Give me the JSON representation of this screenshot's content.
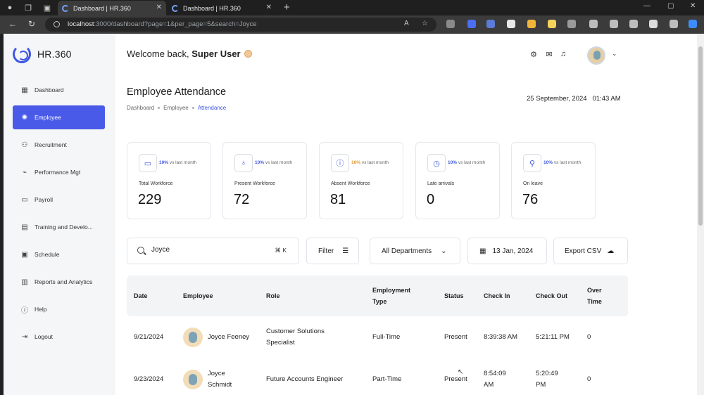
{
  "browser": {
    "tabs": [
      {
        "title": "Dashboard | HR.360",
        "active": true
      },
      {
        "title": "Dashboard | HR.360",
        "active": false
      }
    ],
    "url_host": "localhost",
    "url_path": ":3000/dashboard?page=1&per_page=5&search=Joyce"
  },
  "app": {
    "logo_text": "HR.360",
    "sidebar": [
      {
        "label": "Dashboard",
        "icon": "grid-icon",
        "active": false
      },
      {
        "label": "Employee",
        "icon": "employee-icon",
        "active": true
      },
      {
        "label": "Recruitment",
        "icon": "user-plus-icon",
        "active": false
      },
      {
        "label": "Performance Mgt",
        "icon": "chart-icon",
        "active": false
      },
      {
        "label": "Payroll",
        "icon": "wallet-icon",
        "active": false
      },
      {
        "label": "Training and Develo...",
        "icon": "book-icon",
        "active": false
      },
      {
        "label": "Schedule",
        "icon": "calendar-icon",
        "active": false
      },
      {
        "label": "Reports and Analytics",
        "icon": "report-icon",
        "active": false
      },
      {
        "label": "Help",
        "icon": "help-icon",
        "active": false
      },
      {
        "label": "Logout",
        "icon": "logout-icon",
        "active": false
      }
    ],
    "header": {
      "welcome_prefix": "Welcome back, ",
      "welcome_name": "Super User"
    },
    "page": {
      "title": "Employee Attendance",
      "breadcrumb": [
        "Dashboard",
        "Employee",
        "Attendance"
      ],
      "date": "25 September, 2024",
      "time": "01:43 AM"
    },
    "cards": [
      {
        "trend": "10%",
        "trend_suffix": " vs last month",
        "label": "Total Workforce",
        "value": "229",
        "trend_color": "#3e57e5"
      },
      {
        "trend": "10%",
        "trend_suffix": " vs last month",
        "label": "Present Workforce",
        "value": "72",
        "trend_color": "#3e57e5"
      },
      {
        "trend": "10%",
        "trend_suffix": " vs last month",
        "label": "Absent Workforce",
        "value": "81",
        "trend_color": "#e0962a"
      },
      {
        "trend": "10%",
        "trend_suffix": " vs last month",
        "label": "Late arrivals",
        "value": "0",
        "trend_color": "#3e57e5"
      },
      {
        "trend": "10%",
        "trend_suffix": " vs last month",
        "label": "On leave",
        "value": "76",
        "trend_color": "#3e57e5"
      }
    ],
    "controls": {
      "search_value": "Joyce",
      "search_shortcut": "⌘ K",
      "filter_label": "Filter",
      "department_label": "All Departments",
      "date_label": "13 Jan, 2024",
      "export_label": "Export CSV"
    },
    "table": {
      "headers": [
        "Date",
        "Employee",
        "Role",
        "Employment Type",
        "Status",
        "Check In",
        "Check Out",
        "Over Time"
      ],
      "rows": [
        {
          "date": "9/21/2024",
          "employee": "Joyce Feeney",
          "role": "Customer Solutions Specialist",
          "type": "Full-Time",
          "status": "Present",
          "check_in": "8:39:38 AM",
          "check_out": "5:21:11 PM",
          "overtime": "0"
        },
        {
          "date": "9/23/2024",
          "employee": "Joyce Schmidt",
          "role": "Future Accounts Engineer",
          "type": "Part-Time",
          "status": "Present",
          "check_in": "8:54:09 AM",
          "check_out": "5:20:49 PM",
          "overtime": "0"
        }
      ]
    },
    "accent_color": "#4a5ae8"
  }
}
